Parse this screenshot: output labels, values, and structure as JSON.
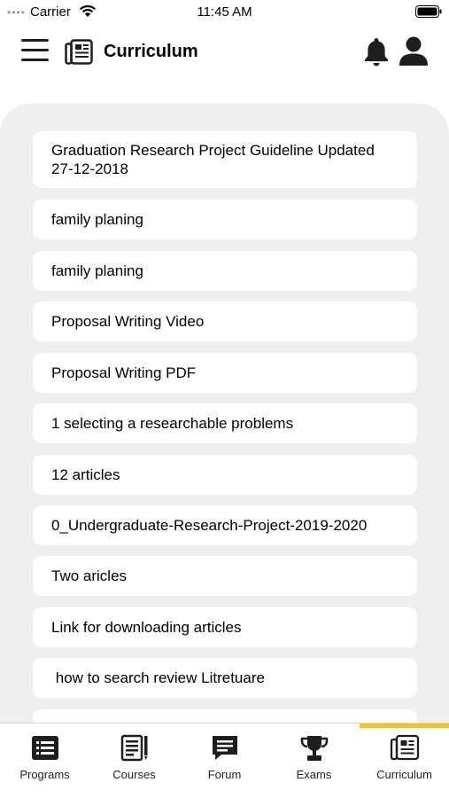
{
  "status_bar": {
    "signal": "••••",
    "carrier": "Carrier",
    "time": "11:45 AM",
    "wifi_icon": "wifi-icon",
    "battery_icon": "battery-icon"
  },
  "header": {
    "title": "Curriculum",
    "menu_icon": "hamburger-menu-icon",
    "logo_icon": "newspaper-icon",
    "notification_icon": "bell-icon",
    "profile_icon": "user-icon"
  },
  "curriculum": {
    "items": [
      {
        "label": "Graduation Research Project Guideline Updated 27-12-2018"
      },
      {
        "label": "family planing"
      },
      {
        "label": "family planing"
      },
      {
        "label": "Proposal Writing Video"
      },
      {
        "label": "Proposal Writing PDF"
      },
      {
        "label": "1 selecting a researchable problems"
      },
      {
        "label": "12 articles"
      },
      {
        "label": "0_Undergraduate-Research-Project-2019-2020"
      },
      {
        "label": "Two aricles"
      },
      {
        "label": "Link for downloading articles"
      },
      {
        "label": " how to search review Litretuare"
      },
      {
        "label": ""
      }
    ]
  },
  "tab_bar": {
    "active_color": "#f3c523",
    "tabs": [
      {
        "label": "Programs",
        "icon": "list-icon"
      },
      {
        "label": "Courses",
        "icon": "notes-icon"
      },
      {
        "label": "Forum",
        "icon": "chat-icon"
      },
      {
        "label": "Exams",
        "icon": "trophy-icon"
      },
      {
        "label": "Curriculum",
        "icon": "newspaper-icon",
        "active": true
      }
    ]
  }
}
